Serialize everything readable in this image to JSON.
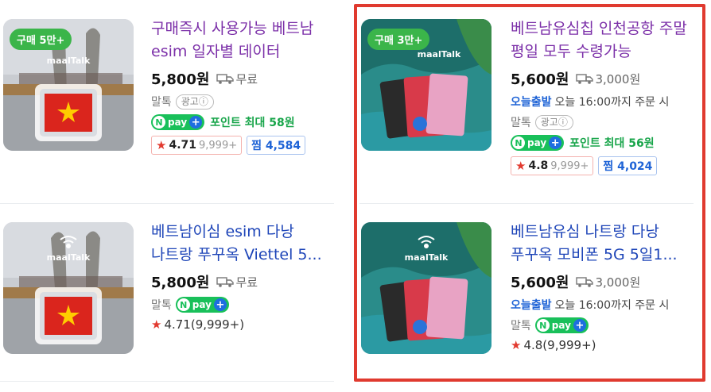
{
  "products": [
    {
      "badge": "구매 5만+",
      "title": "구매즉시 사용가능 베트남 esim 일자별 데이터",
      "price": "5,800원",
      "shipping": "무료",
      "seller": "말톡",
      "ad": "광고ⓘ",
      "npay_point": "포인트 최대 58원",
      "rating": "4.71",
      "review_count": "9,999+",
      "zzim": "찜 4,584",
      "logo": "maalTalk"
    },
    {
      "title": "베트남이심 esim 다낭 나트랑 푸꾸옥 Viettel 5...",
      "price": "5,800원",
      "shipping": "무료",
      "seller": "말톡",
      "rating_text": "4.71(9,999+)",
      "logo": "maalTalk"
    },
    {
      "badge": "구매 3만+",
      "title": "베트남유심칩 인천공항 주말 평일 모두 수령가능",
      "price": "5,600원",
      "shipping": "3,000원",
      "today_label": "오늘출발",
      "today_text": "오늘 16:00까지 주문 시",
      "seller": "말톡",
      "ad": "광고ⓘ",
      "npay_point": "포인트 최대 56원",
      "rating": "4.8",
      "review_count": "9,999+",
      "zzim": "찜 4,024",
      "logo": "maalTalk"
    },
    {
      "title": "베트남유심 나트랑 다낭 푸꾸옥 모비폰 5G 5일1...",
      "price": "5,600원",
      "shipping": "3,000원",
      "today_label": "오늘출발",
      "today_text": "오늘 16:00까지 주문 시",
      "seller": "말톡",
      "rating_text": "4.8(9,999+)",
      "logo": "maalTalk"
    }
  ],
  "npay": {
    "n": "N",
    "pay": "pay",
    "plus": "+"
  },
  "colors": {
    "highlight": "#e03a2f",
    "title_purple": "#7b2fa8",
    "title_blue": "#1e45b8",
    "npay_green": "#19c05a",
    "today_blue": "#1e63d6",
    "badge_green": "#3bb54a"
  },
  "icons": [
    "truck-icon",
    "star-icon",
    "vietnam-flag-icon",
    "sim-card-icon",
    "wifi-icon"
  ]
}
